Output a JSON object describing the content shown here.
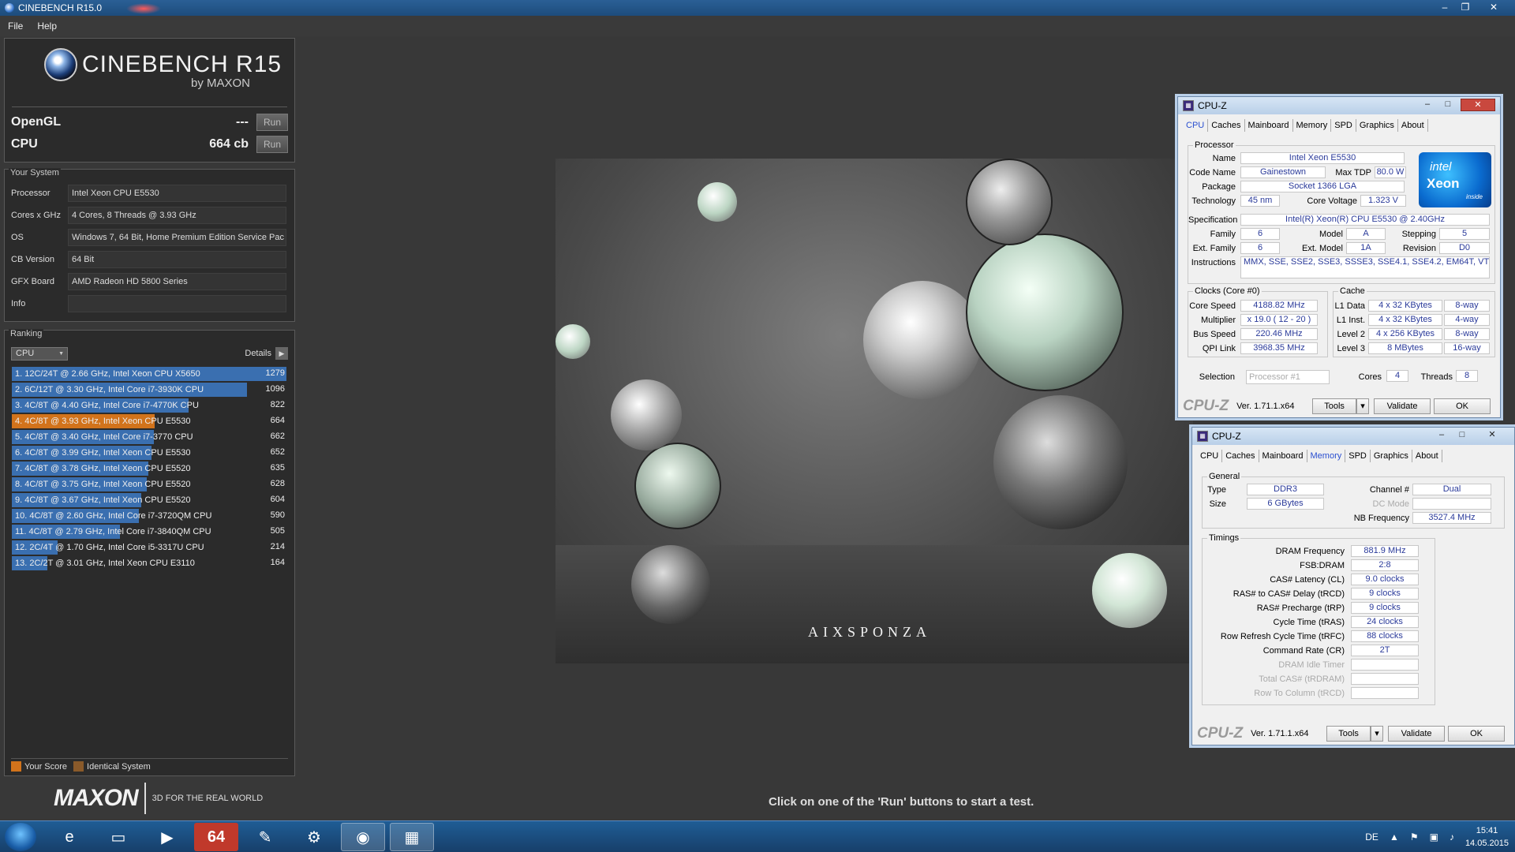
{
  "window": {
    "title": "CINEBENCH R15.0"
  },
  "menu": [
    "File",
    "Help"
  ],
  "logo": {
    "brand": "CINEBENCH R15",
    "by": "by MAXON"
  },
  "tests": {
    "opengl": {
      "label": "OpenGL",
      "value": "---",
      "run": "Run"
    },
    "cpu": {
      "label": "CPU",
      "value": "664 cb",
      "run": "Run"
    }
  },
  "system": {
    "title": "Your System",
    "rows": [
      {
        "label": "Processor",
        "value": "Intel Xeon CPU E5530"
      },
      {
        "label": "Cores x GHz",
        "value": "4 Cores, 8 Threads @ 3.93 GHz"
      },
      {
        "label": "OS",
        "value": "Windows 7, 64 Bit, Home Premium Edition Service Pac"
      },
      {
        "label": "CB Version",
        "value": "64 Bit"
      },
      {
        "label": "GFX Board",
        "value": "AMD Radeon HD 5800 Series"
      },
      {
        "label": "Info",
        "value": ""
      }
    ]
  },
  "ranking": {
    "title": "Ranking",
    "filter": "CPU",
    "details": "Details",
    "max": 1279,
    "rows": [
      {
        "label": "1. 12C/24T @ 2.66 GHz, Intel Xeon CPU X5650",
        "score": 1279,
        "you": false
      },
      {
        "label": "2. 6C/12T @ 3.30 GHz,  Intel Core i7-3930K CPU",
        "score": 1096,
        "you": false
      },
      {
        "label": "3. 4C/8T @ 4.40 GHz, Intel Core i7-4770K CPU",
        "score": 822,
        "you": false
      },
      {
        "label": "4. 4C/8T @ 3.93 GHz, Intel Xeon CPU E5530",
        "score": 664,
        "you": true
      },
      {
        "label": "5. 4C/8T @ 3.40 GHz,  Intel Core i7-3770 CPU",
        "score": 662,
        "you": false
      },
      {
        "label": "6. 4C/8T @ 3.99 GHz, Intel Xeon CPU E5530",
        "score": 652,
        "you": false
      },
      {
        "label": "7. 4C/8T @ 3.78 GHz, Intel Xeon CPU E5520",
        "score": 635,
        "you": false
      },
      {
        "label": "8. 4C/8T @ 3.75 GHz, Intel Xeon CPU E5520",
        "score": 628,
        "you": false
      },
      {
        "label": "9. 4C/8T @ 3.67 GHz, Intel Xeon CPU E5520",
        "score": 604,
        "you": false
      },
      {
        "label": "10. 4C/8T @ 2.60 GHz, Intel Core i7-3720QM CPU",
        "score": 590,
        "you": false
      },
      {
        "label": "11. 4C/8T @ 2.79 GHz,  Intel Core i7-3840QM CPU",
        "score": 505,
        "you": false
      },
      {
        "label": "12. 2C/4T @ 1.70 GHz,  Intel Core i5-3317U CPU",
        "score": 214,
        "you": false
      },
      {
        "label": "13. 2C/2T @ 3.01 GHz, Intel Xeon CPU E3110",
        "score": 164,
        "you": false
      }
    ],
    "legend": {
      "your": "Your Score",
      "identical": "Identical System"
    }
  },
  "footer": {
    "maxon": "MAXON",
    "tagline": "3D FOR THE REAL WORLD",
    "hint": "Click on one of the 'Run' buttons to start a test."
  },
  "render": {
    "watermark": "AIXSPONZA"
  },
  "cpuz1": {
    "title": "CPU-Z",
    "tabs": [
      "CPU",
      "Caches",
      "Mainboard",
      "Memory",
      "SPD",
      "Graphics",
      "About"
    ],
    "active": "CPU",
    "processor": {
      "title": "Processor",
      "name_l": "Name",
      "name": "Intel Xeon E5530",
      "code_l": "Code Name",
      "code": "Gainestown",
      "tdp_l": "Max TDP",
      "tdp": "80.0 W",
      "pkg_l": "Package",
      "pkg": "Socket 1366 LGA",
      "tech_l": "Technology",
      "tech": "45 nm",
      "volt_l": "Core Voltage",
      "volt": "1.323 V",
      "spec_l": "Specification",
      "spec": "Intel(R) Xeon(R) CPU          E5530  @ 2.40GHz",
      "fam_l": "Family",
      "fam": "6",
      "model_l": "Model",
      "model": "A",
      "step_l": "Stepping",
      "step": "5",
      "efam_l": "Ext. Family",
      "efam": "6",
      "emodel_l": "Ext. Model",
      "emodel": "1A",
      "rev_l": "Revision",
      "rev": "D0",
      "instr_l": "Instructions",
      "instr": "MMX, SSE, SSE2, SSE3, SSSE3, SSE4.1, SSE4.2, EM64T, VT-x",
      "logo1": "intel",
      "logo2": "Xeon",
      "logo3": "inside"
    },
    "clocks": {
      "title": "Clocks (Core #0)",
      "cs_l": "Core Speed",
      "cs": "4188.82 MHz",
      "mul_l": "Multiplier",
      "mul": "x 19.0 ( 12 - 20 )",
      "bus_l": "Bus Speed",
      "bus": "220.46 MHz",
      "qpi_l": "QPI Link",
      "qpi": "3968.35 MHz"
    },
    "cache": {
      "title": "Cache",
      "l1d_l": "L1 Data",
      "l1d": "4 x 32 KBytes",
      "l1d_w": "8-way",
      "l1i_l": "L1 Inst.",
      "l1i": "4 x 32 KBytes",
      "l1i_w": "4-way",
      "l2_l": "Level 2",
      "l2": "4 x 256 KBytes",
      "l2_w": "8-way",
      "l3_l": "Level 3",
      "l3": "8 MBytes",
      "l3_w": "16-way"
    },
    "sel_l": "Selection",
    "sel": "Processor #1",
    "cores_l": "Cores",
    "cores": "4",
    "threads_l": "Threads",
    "threads": "8",
    "footer": {
      "logo": "CPU-Z",
      "ver": "Ver. 1.71.1.x64",
      "tools": "Tools",
      "validate": "Validate",
      "ok": "OK"
    }
  },
  "cpuz2": {
    "title": "CPU-Z",
    "tabs": [
      "CPU",
      "Caches",
      "Mainboard",
      "Memory",
      "SPD",
      "Graphics",
      "About"
    ],
    "active": "Memory",
    "general": {
      "title": "General",
      "type_l": "Type",
      "type": "DDR3",
      "size_l": "Size",
      "size": "6 GBytes",
      "chan_l": "Channel #",
      "chan": "Dual",
      "dc_l": "DC Mode",
      "dc": "",
      "nb_l": "NB Frequency",
      "nb": "3527.4 MHz"
    },
    "timings": {
      "title": "Timings",
      "rows": [
        {
          "label": "DRAM Frequency",
          "value": "881.9 MHz",
          "dim": false
        },
        {
          "label": "FSB:DRAM",
          "value": "2:8",
          "dim": false
        },
        {
          "label": "CAS# Latency (CL)",
          "value": "9.0 clocks",
          "dim": false
        },
        {
          "label": "RAS# to CAS# Delay (tRCD)",
          "value": "9 clocks",
          "dim": false
        },
        {
          "label": "RAS# Precharge (tRP)",
          "value": "9 clocks",
          "dim": false
        },
        {
          "label": "Cycle Time (tRAS)",
          "value": "24 clocks",
          "dim": false
        },
        {
          "label": "Row Refresh Cycle Time (tRFC)",
          "value": "88 clocks",
          "dim": false
        },
        {
          "label": "Command Rate (CR)",
          "value": "2T",
          "dim": false
        },
        {
          "label": "DRAM Idle Timer",
          "value": "",
          "dim": true
        },
        {
          "label": "Total CAS# (tRDRAM)",
          "value": "",
          "dim": true
        },
        {
          "label": "Row To Column (tRCD)",
          "value": "",
          "dim": true
        }
      ]
    },
    "footer": {
      "logo": "CPU-Z",
      "ver": "Ver. 1.71.1.x64",
      "tools": "Tools",
      "validate": "Validate",
      "ok": "OK"
    }
  },
  "taskbar": {
    "apps": [
      "ie-icon",
      "explorer-icon",
      "media-player-icon",
      "aida64-icon",
      "paint-icon",
      "tool-icon",
      "cinebench-icon",
      "cpuz-icon"
    ],
    "aida_label": "64",
    "lang": "DE",
    "time": "15:41",
    "date": "14.05.2015"
  }
}
